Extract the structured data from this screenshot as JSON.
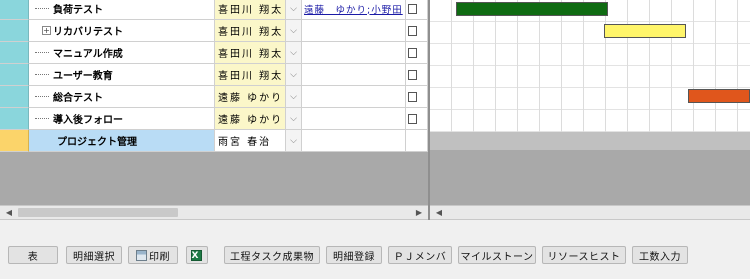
{
  "tasks": [
    {
      "name": "負荷テスト",
      "owner": "喜田川 翔太",
      "members": "遠藤　ゆかり;小野田",
      "tree": "leaf"
    },
    {
      "name": "リカバリテスト",
      "owner": "喜田川 翔太",
      "members": "",
      "tree": "collapsed"
    },
    {
      "name": "マニュアル作成",
      "owner": "喜田川 翔太",
      "members": "",
      "tree": "leaf"
    },
    {
      "name": "ユーザー教育",
      "owner": "喜田川 翔太",
      "members": "",
      "tree": "leaf"
    },
    {
      "name": "総合テスト",
      "owner": "遠藤 ゆかり",
      "members": "",
      "tree": "leaf"
    },
    {
      "name": "導入後フォロー",
      "owner": "遠藤 ゆかり",
      "members": "",
      "tree": "leaf"
    },
    {
      "name": "プロジェクト管理",
      "owner": "雨宮 春治",
      "members": "",
      "tree": "root"
    }
  ],
  "gantt_bars": [
    {
      "task": "負荷テスト",
      "color": "#0f6b12"
    },
    {
      "task": "リカバリテスト",
      "color": "#fff56a"
    },
    {
      "task": "総合テスト",
      "color": "#e0561c"
    }
  ],
  "icons": {
    "expand": "plus-box-icon",
    "dropdown": "chevron-down-icon",
    "print": "printer-icon",
    "excel": "excel-icon"
  },
  "toolbar": {
    "table": "表",
    "detail_select": "明細選択",
    "print": "印刷",
    "excel": "X",
    "deliverables": "工程タスク成果物",
    "detail_register": "明細登録",
    "pj_members": "ＰＪメンバ",
    "milestones": "マイルストーン",
    "resource_histogram": "リソースヒスト",
    "effort_entry": "工数入力"
  }
}
